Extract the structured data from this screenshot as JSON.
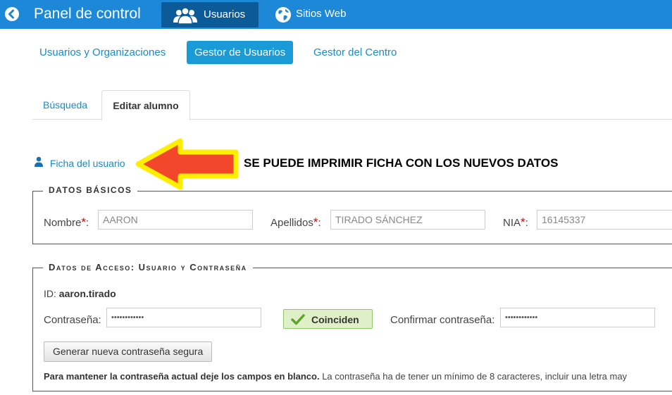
{
  "topbar": {
    "title": "Panel de control",
    "nav": [
      {
        "label": "Usuarios",
        "icon": "users-icon"
      },
      {
        "label": "Sitios Web",
        "icon": "globe-icon"
      }
    ]
  },
  "subnav": [
    "Usuarios y Organizaciones",
    "Gestor de Usuarios",
    "Gestor del Centro"
  ],
  "tabs": [
    "Búsqueda",
    "Editar alumno"
  ],
  "ficha_link": "Ficha del usuario",
  "annotation": "SE PUEDE IMPRIMIR FICHA CON LOS NUEVOS DATOS",
  "basic": {
    "legend": "Datos básicos",
    "nombre_label": "Nombre",
    "nombre_value": "AARON",
    "apellidos_label": "Apellidos",
    "apellidos_value": "TIRADO SÁNCHEZ",
    "nia_label": "NIA",
    "nia_value": "16145337",
    "required_mark": "*",
    "colon": ":"
  },
  "access": {
    "legend": "Datos de Acceso: Usuario y Contraseña",
    "id_label": "ID:",
    "id_value": "aaron.tirado",
    "password_label": "Contraseña:",
    "password_value": "••••••••••••",
    "match_label": "Coinciden",
    "confirm_label": "Confirmar contraseña:",
    "confirm_value": "••••••••••••",
    "generate_button": "Generar nueva contraseña segura",
    "help_bold": "Para mantener la contraseña actual deje los campos en blanco.",
    "help_text": " La contraseña ha de tener un mínimo de 8 caracteres, incluir una letra may"
  },
  "colors": {
    "topbar": "#1e88d8",
    "active_nav": "#0d5a99",
    "link": "#1a8bc6",
    "active_subtab": "#1a9ad6",
    "arrow_fill": "#f2472a",
    "arrow_outline": "#ffee00",
    "required": "#cc0000",
    "match_bg": "#dff0c8"
  }
}
